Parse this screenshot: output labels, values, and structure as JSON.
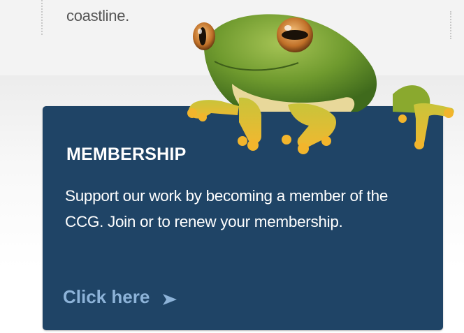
{
  "intro": {
    "text": "coastline."
  },
  "membership": {
    "title": "MEMBERSHIP",
    "body": "Support our work by becoming a member of the CCG. Join or to renew your membership.",
    "link_label": "Click here",
    "link_icon": "arrow-right-icon"
  },
  "colors": {
    "card_background": "#1f4466",
    "link_color": "#8db3d8",
    "top_background": "#f3f3f3"
  },
  "image": {
    "subject": "frog"
  }
}
